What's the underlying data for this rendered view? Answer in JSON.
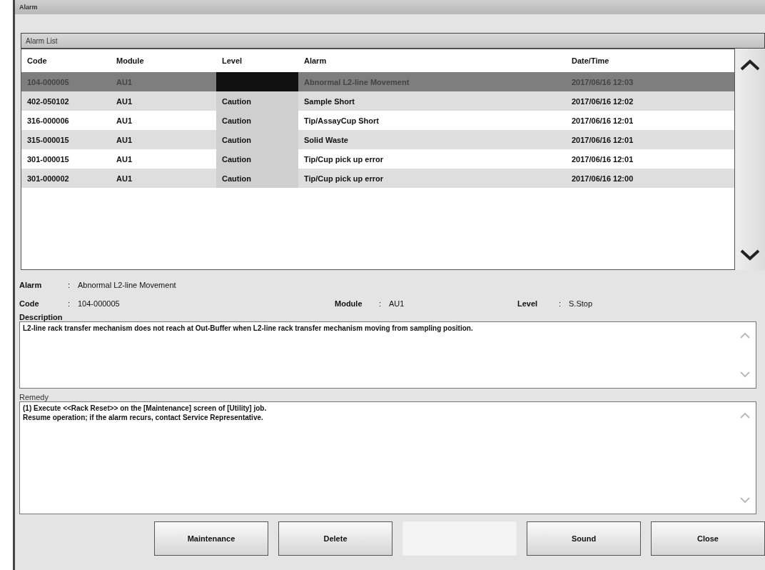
{
  "window": {
    "title": "Alarm"
  },
  "alarm_list": {
    "title": "Alarm List",
    "columns": [
      "Code",
      "Module",
      "Level",
      "Alarm",
      "Date/Time"
    ],
    "rows": [
      {
        "code": "104-000005",
        "module": "AU1",
        "alarm": "Abnormal L2-line Movement",
        "date_time": "2017/06/16 12:03",
        "selected": true
      },
      {
        "code": "402-050102",
        "module": "AU1",
        "level": "Caution",
        "alarm": "Sample Short",
        "date_time": "2017/06/16 12:02",
        "selected": false
      },
      {
        "code": "316-000006",
        "module": "AU1",
        "level": "Caution",
        "alarm": "Tip/AssayCup Short",
        "date_time": "2017/06/16 12:01",
        "selected": false
      },
      {
        "code": "315-000015",
        "module": "AU1",
        "level": "Caution",
        "alarm": "Solid Waste",
        "date_time": "2017/06/16 12:01",
        "selected": false
      },
      {
        "code": "301-000015",
        "module": "AU1",
        "level": "Caution",
        "alarm": "Tip/Cup pick up error",
        "date_time": "2017/06/16 12:01",
        "selected": false
      },
      {
        "code": "301-000002",
        "module": "AU1",
        "level": "Caution",
        "alarm": "Tip/Cup pick up error",
        "date_time": "2017/06/16 12:00",
        "selected": false
      }
    ]
  },
  "details": {
    "alarm_label": "Alarm",
    "alarm_value": "Abnormal L2-line Movement",
    "code_label": "Code",
    "code_value": "104-000005",
    "module_label": "Module",
    "module_value": "AU1",
    "level_label": "Level",
    "level_value": "S.Stop",
    "separator": ":",
    "description_label": "Description",
    "description": "L2-line rack transfer mechanism does not reach at Out-Buffer when L2-line rack transfer mechanism moving from sampling position.",
    "remedy_label": "Remedy",
    "remedy": [
      "(1) Execute <<Rack Reset>> on the [Maintenance] screen of [Utility] job.",
      "Resume operation; if the alarm recurs, contact Service Representative."
    ]
  },
  "buttons": [
    {
      "label": "Maintenance",
      "disabled": false
    },
    {
      "label": "Delete",
      "disabled": false
    },
    {
      "disabled": true
    },
    {
      "label": "Sound",
      "disabled": false
    },
    {
      "label": "Close",
      "disabled": false
    }
  ]
}
